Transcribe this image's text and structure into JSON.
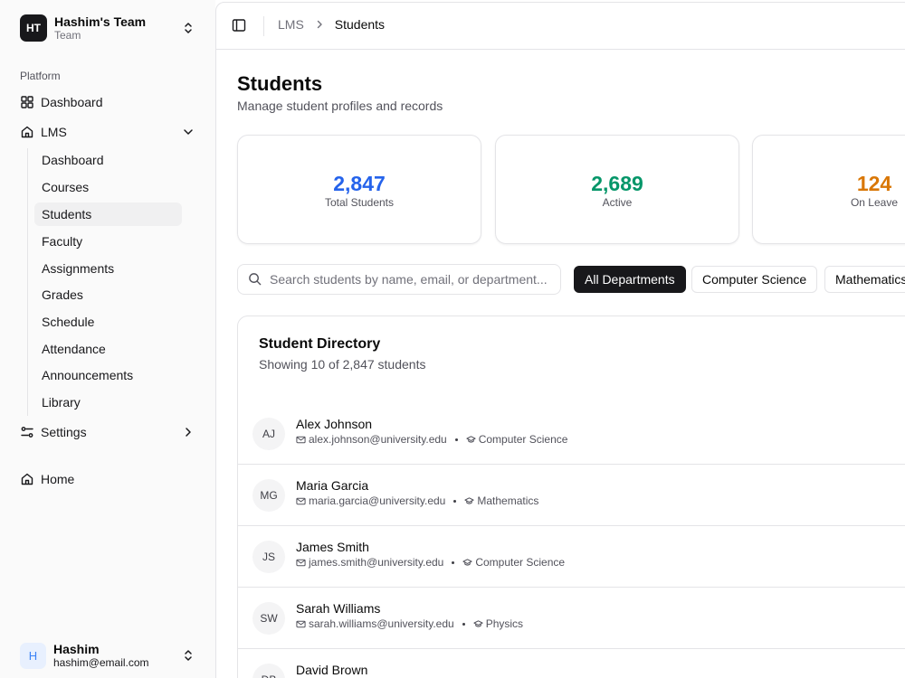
{
  "team": {
    "initials": "HT",
    "name": "Hashim's Team",
    "plan": "Team"
  },
  "sidebar": {
    "group_label": "Platform",
    "dashboard": "Dashboard",
    "lms": "LMS",
    "lms_items": [
      "Dashboard",
      "Courses",
      "Students",
      "Faculty",
      "Assignments",
      "Grades",
      "Schedule",
      "Attendance",
      "Announcements",
      "Library"
    ],
    "active_item": "Students",
    "settings": "Settings",
    "home": "Home"
  },
  "user": {
    "initial": "H",
    "name": "Hashim",
    "email": "hashim@email.com"
  },
  "breadcrumb": {
    "parent": "LMS",
    "current": "Students"
  },
  "page": {
    "title": "Students",
    "subtitle": "Manage student profiles and records"
  },
  "stats": [
    {
      "value": "2,847",
      "label": "Total Students",
      "color": "#2563eb"
    },
    {
      "value": "2,689",
      "label": "Active",
      "color": "#059669"
    },
    {
      "value": "124",
      "label": "On Leave",
      "color": "#d97706"
    }
  ],
  "search": {
    "placeholder": "Search students by name, email, or department...",
    "value": ""
  },
  "filters": [
    "All Departments",
    "Computer Science",
    "Mathematics"
  ],
  "directory": {
    "title": "Student Directory",
    "subtitle": "Showing 10 of 2,847 students",
    "students": [
      {
        "initials": "AJ",
        "name": "Alex Johnson",
        "email": "alex.johnson@university.edu",
        "department": "Computer Science"
      },
      {
        "initials": "MG",
        "name": "Maria Garcia",
        "email": "maria.garcia@university.edu",
        "department": "Mathematics"
      },
      {
        "initials": "JS",
        "name": "James Smith",
        "email": "james.smith@university.edu",
        "department": "Computer Science"
      },
      {
        "initials": "SW",
        "name": "Sarah Williams",
        "email": "sarah.williams@university.edu",
        "department": "Physics"
      },
      {
        "initials": "DB",
        "name": "David Brown",
        "email": "",
        "department": ""
      }
    ]
  }
}
